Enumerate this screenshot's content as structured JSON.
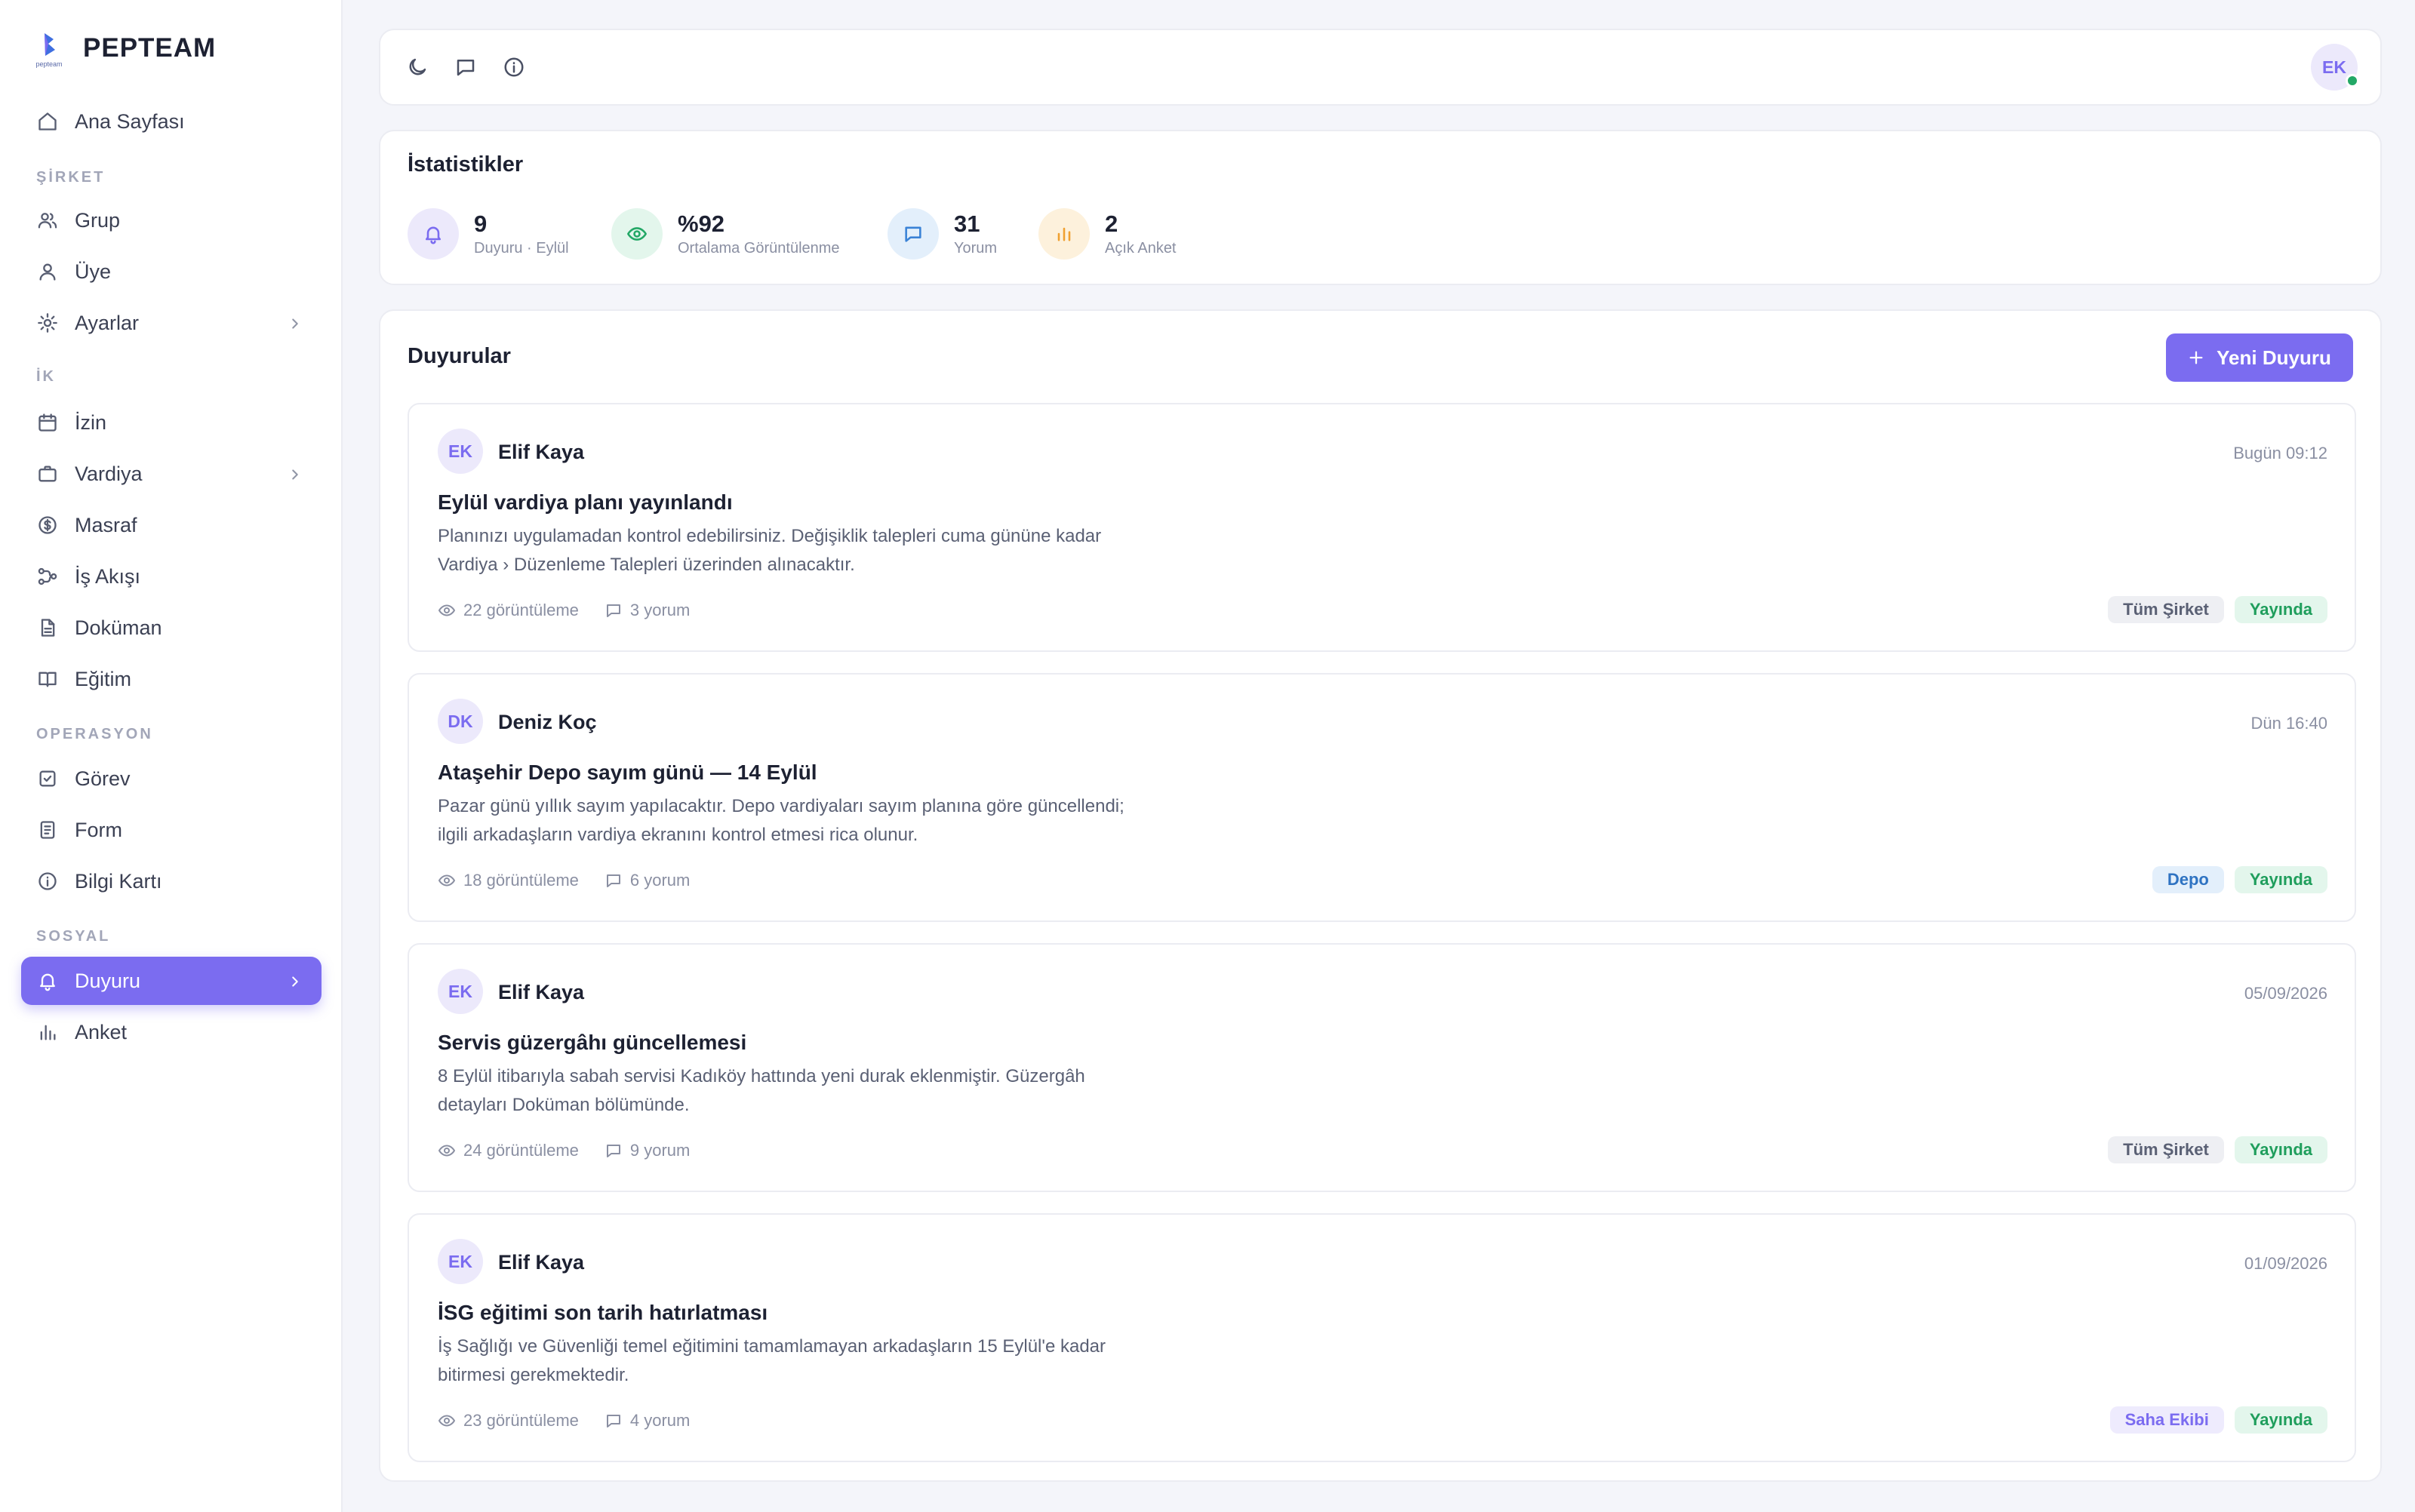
{
  "app": {
    "name": "PEPTEAM",
    "logo_text": "pepteam"
  },
  "sidebar": {
    "home": {
      "label": "Ana Sayfası",
      "icon": "home-icon"
    },
    "sections": [
      {
        "label": "ŞİRKET",
        "items": [
          {
            "label": "Grup",
            "icon": "users-icon"
          },
          {
            "label": "Üye",
            "icon": "user-icon"
          },
          {
            "label": "Ayarlar",
            "icon": "gear-icon",
            "has_children": true
          }
        ]
      },
      {
        "label": "İK",
        "items": [
          {
            "label": "İzin",
            "icon": "calendar-icon"
          },
          {
            "label": "Vardiya",
            "icon": "briefcase-icon",
            "has_children": true
          },
          {
            "label": "Masraf",
            "icon": "dollar-icon"
          },
          {
            "label": "İş Akışı",
            "icon": "workflow-icon"
          },
          {
            "label": "Doküman",
            "icon": "document-icon"
          },
          {
            "label": "Eğitim",
            "icon": "book-icon"
          }
        ]
      },
      {
        "label": "OPERASYON",
        "items": [
          {
            "label": "Görev",
            "icon": "task-icon"
          },
          {
            "label": "Form",
            "icon": "form-icon"
          },
          {
            "label": "Bilgi Kartı",
            "icon": "info-icon"
          }
        ]
      },
      {
        "label": "SOSYAL",
        "items": [
          {
            "label": "Duyuru",
            "icon": "bell-icon",
            "active": true,
            "has_children": true
          },
          {
            "label": "Anket",
            "icon": "bar-chart-icon"
          }
        ]
      }
    ]
  },
  "topbar": {
    "icons": [
      "moon-icon",
      "message-icon",
      "info-icon"
    ],
    "user_initials": "EK",
    "user_status": "online"
  },
  "stats": {
    "title": "İstatistikler",
    "items": [
      {
        "value": "9",
        "label": "Duyuru · Eylül",
        "icon": "bell-icon",
        "color": "#7b6cf0",
        "bg": "#ece9fb"
      },
      {
        "value": "%92",
        "label": "Ortalama Görüntülenme",
        "icon": "eye-icon",
        "color": "#23a866",
        "bg": "#e3f6ec"
      },
      {
        "value": "31",
        "label": "Yorum",
        "icon": "message-icon",
        "color": "#3a82d6",
        "bg": "#e3effb"
      },
      {
        "value": "2",
        "label": "Açık Anket",
        "icon": "bar-chart-icon",
        "color": "#f0a030",
        "bg": "#fdf1dc"
      }
    ]
  },
  "announcements": {
    "title": "Duyurular",
    "new_button": "Yeni Duyuru",
    "posts": [
      {
        "initials": "EK",
        "author": "Elif Kaya",
        "date": "Bugün 09:12",
        "title": "Eylül vardiya planı yayınlandı",
        "body_lines": [
          "Planınızı uygulamadan kontrol edebilirsiniz. Değişiklik talepleri cuma gününe kadar",
          "Vardiya › Düzenleme Talepleri üzerinden alınacaktır."
        ],
        "views": "22 görüntüleme",
        "comments": "3 yorum",
        "tags": [
          {
            "label": "Tüm Şirket",
            "style": "grey"
          },
          {
            "label": "Yayında",
            "style": "green"
          }
        ]
      },
      {
        "initials": "DK",
        "author": "Deniz Koç",
        "date": "Dün 16:40",
        "title": "Ataşehir Depo sayım günü — 14 Eylül",
        "body_lines": [
          "Pazar günü yıllık sayım yapılacaktır. Depo vardiyaları sayım planına göre güncellendi;",
          "ilgili arkadaşların vardiya ekranını kontrol etmesi rica olunur."
        ],
        "views": "18 görüntüleme",
        "comments": "6 yorum",
        "tags": [
          {
            "label": "Depo",
            "style": "blue"
          },
          {
            "label": "Yayında",
            "style": "green"
          }
        ]
      },
      {
        "initials": "EK",
        "author": "Elif Kaya",
        "date": "05/09/2026",
        "title": "Servis güzergâhı güncellemesi",
        "body_lines": [
          "8 Eylül itibarıyla sabah servisi Kadıköy hattında yeni durak eklenmiştir. Güzergâh",
          "detayları Doküman bölümünde."
        ],
        "views": "24 görüntüleme",
        "comments": "9 yorum",
        "tags": [
          {
            "label": "Tüm Şirket",
            "style": "grey"
          },
          {
            "label": "Yayında",
            "style": "green"
          }
        ]
      },
      {
        "initials": "EK",
        "author": "Elif Kaya",
        "date": "01/09/2026",
        "title": "İSG eğitimi son tarih hatırlatması",
        "body_lines": [
          "İş Sağlığı ve Güvenliği temel eğitimini tamamlamayan arkadaşların 15 Eylül'e kadar",
          "bitirmesi gerekmektedir."
        ],
        "views": "23 görüntüleme",
        "comments": "4 yorum",
        "tags": [
          {
            "label": "Saha Ekibi",
            "style": "purple"
          },
          {
            "label": "Yayında",
            "style": "green"
          }
        ]
      }
    ]
  }
}
